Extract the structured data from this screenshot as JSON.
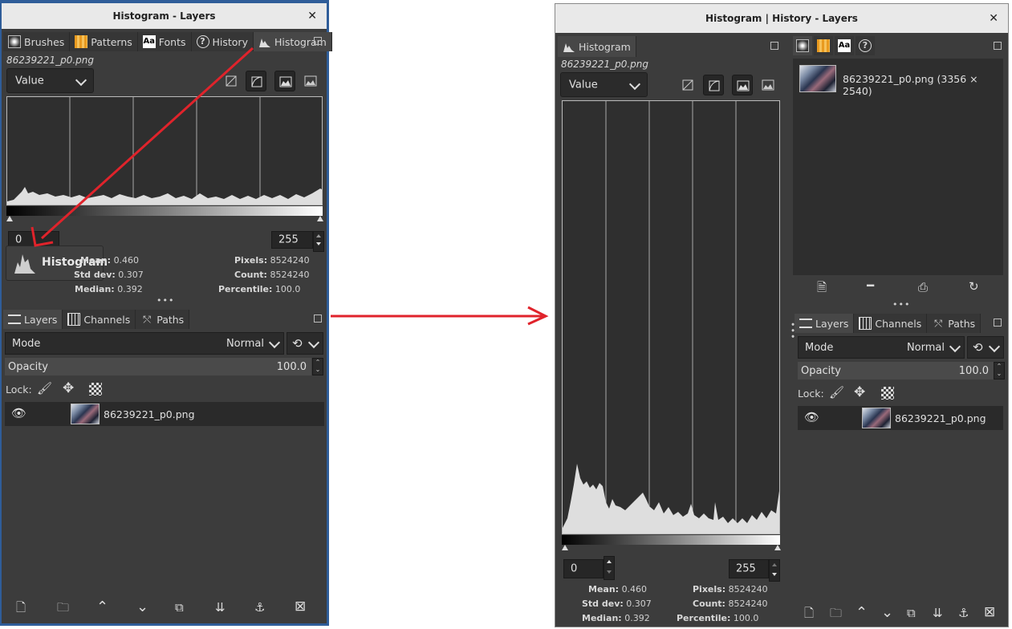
{
  "left_window": {
    "title": "Histogram - Layers",
    "close": "✕",
    "tabs": [
      "Brushes",
      "Patterns",
      "Fonts",
      "History",
      "Histogram"
    ],
    "filename": "86239221_p0.png",
    "channel": "Value",
    "range_low": "0",
    "range_high": "255",
    "tooltip": "Histogram",
    "stats": {
      "mean_label": "Mean:",
      "mean": "0.460",
      "std_label": "Std dev:",
      "std": "0.307",
      "median_label": "Median:",
      "median": "0.392",
      "pixels_label": "Pixels:",
      "pixels": "8524240",
      "count_label": "Count:",
      "count": "8524240",
      "percentile_label": "Percentile:",
      "percentile": "100.0"
    },
    "layer_tabs": [
      "Layers",
      "Channels",
      "Paths"
    ],
    "mode_label": "Mode",
    "mode_value": "Normal",
    "opacity_label": "Opacity",
    "opacity_value": "100.0",
    "lock_label": "Lock:",
    "layer_name": "86239221_p0.png"
  },
  "right_window": {
    "title": "Histogram | History - Layers",
    "close": "✕",
    "hist_tab": "Histogram",
    "filename": "86239221_p0.png",
    "channel": "Value",
    "range_low": "0",
    "range_high": "255",
    "image_entry": "86239221_p0.png (3356 × 2540)",
    "stats": {
      "mean_label": "Mean:",
      "mean": "0.460",
      "std_label": "Std dev:",
      "std": "0.307",
      "median_label": "Median:",
      "median": "0.392",
      "pixels_label": "Pixels:",
      "pixels": "8524240",
      "count_label": "Count:",
      "count": "8524240",
      "percentile_label": "Percentile:",
      "percentile": "100.0"
    },
    "layer_tabs": [
      "Layers",
      "Channels",
      "Paths"
    ],
    "mode_label": "Mode",
    "mode_value": "Normal",
    "opacity_label": "Opacity",
    "opacity_value": "100.0",
    "lock_label": "Lock:",
    "layer_name": "86239221_p0.png"
  },
  "colors": {
    "annotation_arrow": "#e0232b",
    "panel_bg": "#3c3c3c",
    "window_frame_left": "#2f5d99"
  }
}
